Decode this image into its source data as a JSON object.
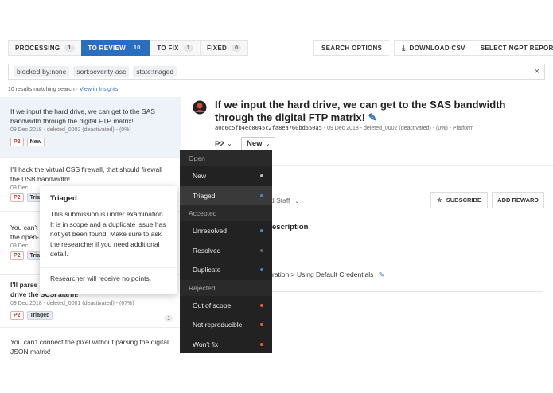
{
  "tabs": [
    {
      "label": "PROCESSING",
      "count": "1"
    },
    {
      "label": "TO REVIEW",
      "count": "10"
    },
    {
      "label": "TO FIX",
      "count": "1"
    },
    {
      "label": "FIXED",
      "count": "0"
    }
  ],
  "toolbar": {
    "search_options": "SEARCH OPTIONS",
    "download_csv": "DOWNLOAD CSV",
    "download_icon": "download-icon",
    "select_report": "SELECT NGPT REPORT"
  },
  "search": {
    "chips": [
      "blocked-by:none",
      "sort:severity-asc",
      "state:triaged"
    ],
    "clear": "×"
  },
  "results": {
    "text": "10 results matching search",
    "sep": " · ",
    "link": "View in Insights"
  },
  "list": [
    {
      "title": "If we input the hard drive, we can get to the SAS bandwidth through the digital FTP matrix!",
      "meta": "09 Dec 2018 - deleted_0002 (deactivated) - (0%)",
      "severity": "P2",
      "state": "New"
    },
    {
      "title": "I'll hack the virtual CSS firewall, that should firewall the USB bandwidth!",
      "meta": "09 Dec",
      "severity": "P2",
      "state": "Tria"
    },
    {
      "title": "You can't",
      "title2": "the open-",
      "meta": "09 Dec",
      "severity": "P2",
      "state": "Tria"
    },
    {
      "title": "I'll parse",
      "title2": "drive the SCSI alarm!",
      "meta": "09 Dec 2018 - deleted_0001 (deactivated) - (67%)",
      "severity": "P2",
      "state": "Triaged",
      "count": "1"
    },
    {
      "title": "You can't connect the pixel without parsing the digital JSON matrix!"
    }
  ],
  "tooltip": {
    "heading": "Triaged",
    "description": "This submission is under examination. It is in scope and a duplicate issue has not yet been found. Make sure to ask the researcher if you need additional detail.",
    "footer": "Researcher will receive no points."
  },
  "report": {
    "title": "If we input the hard drive, we can get to the SAS bandwidth through the digital FTP matrix!",
    "hash": "a0d6c5fb4ec0045c2fa8ea760bd550a5",
    "meta": " - 09 Dec 2018 - deleted_0002 (deactivated) - (0%) - Platform",
    "severity": "P2",
    "state": "New",
    "assignee": "d Staff",
    "subscribe": "SUBSCRIBE",
    "add_reward": "ADD REWARD",
    "description_heading": "escription",
    "weakness": "ration > Using Default Credentials"
  },
  "dropdown": {
    "groups": [
      {
        "label": "Open",
        "items": [
          {
            "label": "New",
            "color": "#bbbbbb"
          },
          {
            "label": "Triaged",
            "color": "#4a7fd6",
            "active": true
          }
        ]
      },
      {
        "label": "Accepted",
        "items": [
          {
            "label": "Unresolved",
            "color": "#4a7fd6"
          },
          {
            "label": "Resolved",
            "color": "#666666"
          },
          {
            "label": "Duplicate",
            "color": "#4a7fd6"
          }
        ]
      },
      {
        "label": "Rejected",
        "items": [
          {
            "label": "Out of scope",
            "color": "#e0613a"
          },
          {
            "label": "Not reproducible",
            "color": "#e0613a"
          },
          {
            "label": "Won't fix",
            "color": "#e0613a"
          }
        ]
      }
    ]
  },
  "colors": {
    "accent": "#2a6fbf",
    "dropdown_bg": "#222222"
  }
}
